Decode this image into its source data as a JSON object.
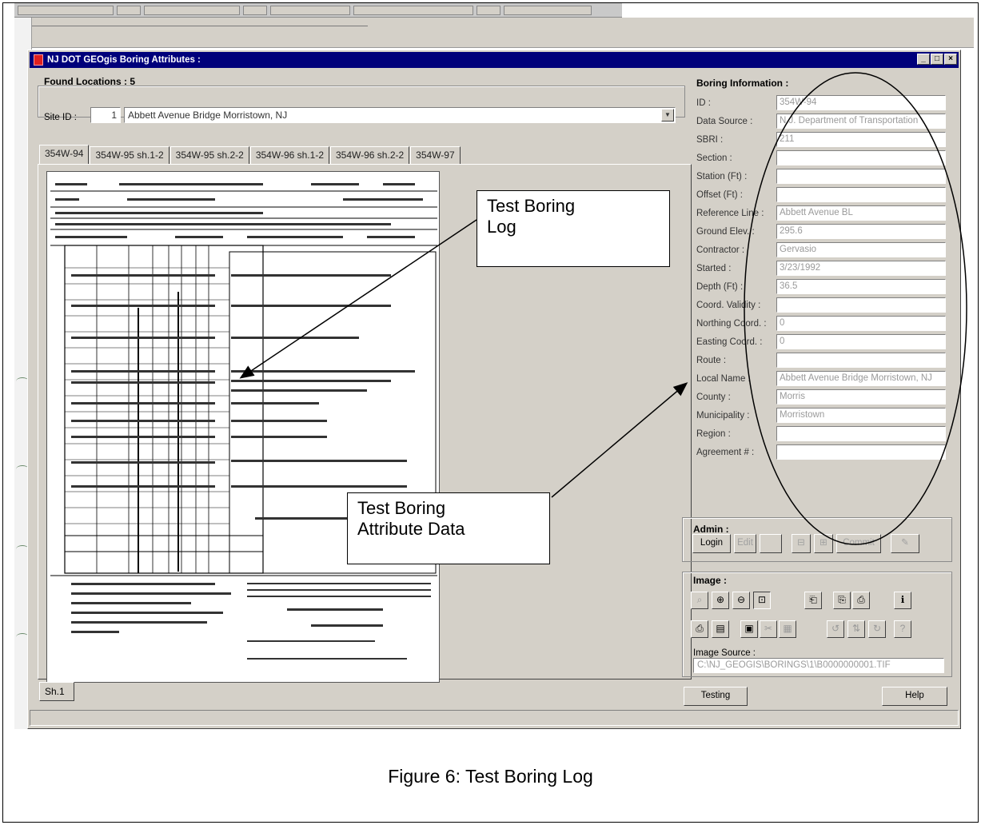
{
  "window": {
    "title": "NJ DOT GEOgis   Boring Attributes :",
    "buttons": [
      "_",
      "□",
      "×"
    ]
  },
  "left": {
    "found_label": "Found Locations :  5",
    "site_id_label": "Site ID :",
    "site_id_value": "1",
    "site_combo_value": "Abbett Avenue Bridge Morristown, NJ",
    "tabs": [
      "354W-94",
      "354W-95 sh.1-2",
      "354W-95 sh.2-2",
      "354W-96 sh.1-2",
      "354W-96 sh.2-2",
      "354W-97"
    ],
    "sheet_tab": "Sh.1"
  },
  "boring_info": {
    "title": "Boring Information :",
    "rows": [
      {
        "label": "ID :",
        "value": "354W-94"
      },
      {
        "label": "Data Source :",
        "value": "N.J. Department of Transportation"
      },
      {
        "label": "SBRI :",
        "value": "211"
      },
      {
        "label": "Section :",
        "value": ""
      },
      {
        "label": "Station (Ft) :",
        "value": ""
      },
      {
        "label": "Offset (Ft) :",
        "value": ""
      },
      {
        "label": "Reference Line :",
        "value": "Abbett Avenue BL"
      },
      {
        "label": "Ground Elev. :",
        "value": "295.6"
      },
      {
        "label": "Contractor :",
        "value": "Gervasio"
      },
      {
        "label": "Started :",
        "value": "3/23/1992"
      },
      {
        "label": "Depth (Ft) :",
        "value": "36.5"
      },
      {
        "label": "Coord. Validity :",
        "value": ""
      },
      {
        "label": "Northing Coord. :",
        "value": "0"
      },
      {
        "label": "Easting Coord. :",
        "value": "0"
      },
      {
        "label": "Route :",
        "value": ""
      },
      {
        "label": "Local Name :",
        "value": "Abbett Avenue Bridge Morristown, NJ"
      },
      {
        "label": "County :",
        "value": "Morris"
      },
      {
        "label": "Municipality :",
        "value": "Morristown"
      },
      {
        "label": "Region :",
        "value": ""
      },
      {
        "label": "Agreement # :",
        "value": ""
      }
    ]
  },
  "admin": {
    "title": "Admin :",
    "login": "Login",
    "edit": "Edit",
    "commit": "Commit"
  },
  "image": {
    "title": "Image :",
    "source_label": "Image Source :",
    "source_value": "C:\\NJ_GEOGIS\\BORINGS\\1\\B0000000001.TIF"
  },
  "footer": {
    "testing": "Testing",
    "help": "Help"
  },
  "annotations": {
    "callout_log": [
      "Test Boring",
      "Log"
    ],
    "callout_attr": [
      "Test Boring",
      "Attribute Data"
    ]
  },
  "caption": "Figure 6: Test Boring Log",
  "colors": {
    "titlebar": "#00007b",
    "face": "#d4d0c8",
    "disabled_text": "#9a9a9a"
  }
}
